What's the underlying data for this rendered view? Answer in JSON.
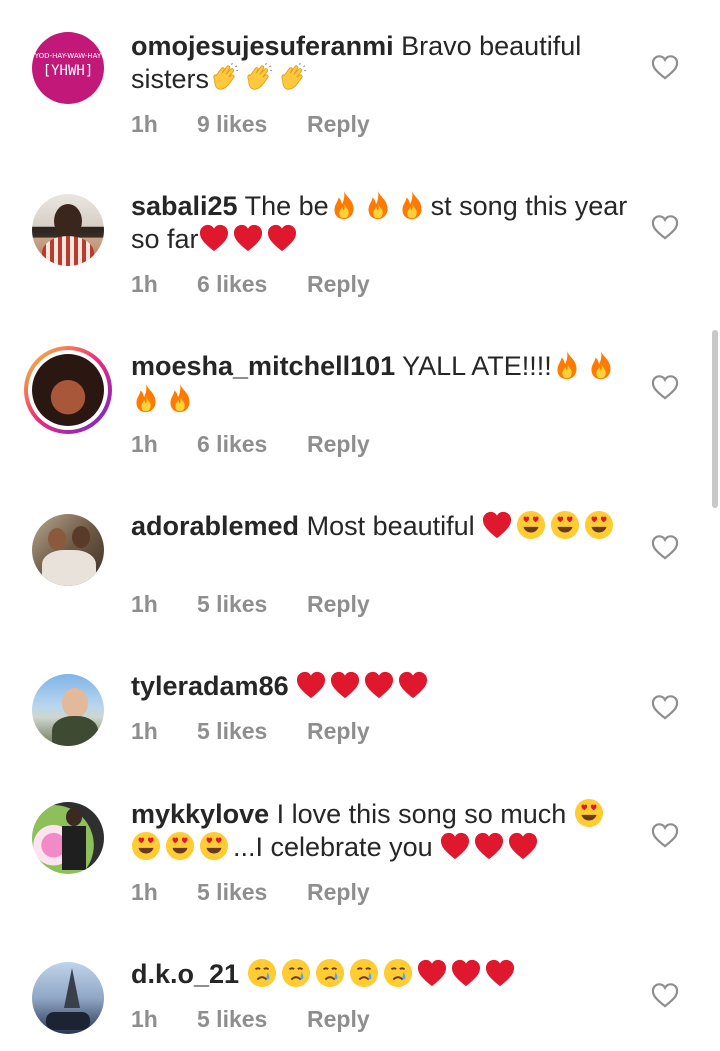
{
  "comments": [
    {
      "username": "omojesujesuferanmi",
      "text": "Bravo beautiful sisters",
      "trail": "",
      "time": "1h",
      "likes": "9 likes",
      "reply": "Reply",
      "avatar_text_top": "YOD-HAY-WAW-HAY",
      "avatar_text_main": "[YHWH]"
    },
    {
      "username": "sabali25",
      "text_a": "The be",
      "text_b": "st song this year so far",
      "time": "1h",
      "likes": "6 likes",
      "reply": "Reply"
    },
    {
      "username": "moesha_mitchell101",
      "text": "YALL ATE!!!!",
      "time": "1h",
      "likes": "6 likes",
      "reply": "Reply"
    },
    {
      "username": "adorablemed",
      "text": "Most beautiful",
      "time": "1h",
      "likes": "5 likes",
      "reply": "Reply"
    },
    {
      "username": "tyleradam86",
      "text": "",
      "time": "1h",
      "likes": "5 likes",
      "reply": "Reply"
    },
    {
      "username": "mykkylove",
      "text": "I love this song so much",
      "text_b": "...I celebrate you",
      "time": "1h",
      "likes": "5 likes",
      "reply": "Reply"
    },
    {
      "username": "d.k.o_21",
      "text": "",
      "time": "1h",
      "likes": "5 likes",
      "reply": "Reply"
    }
  ],
  "icons": {
    "like": "heart-outline-icon",
    "clap": "clapping-hands-emoji",
    "fire": "fire-emoji",
    "red_heart": "red-heart-emoji",
    "heart_eyes": "heart-eyes-emoji",
    "crying": "crying-face-emoji"
  },
  "colors": {
    "muted": "#8e8e8e",
    "text": "#262626",
    "heart_red": "#e0182d",
    "fire": "#ff8a00",
    "emoji_yellow": "#ffcc33"
  }
}
